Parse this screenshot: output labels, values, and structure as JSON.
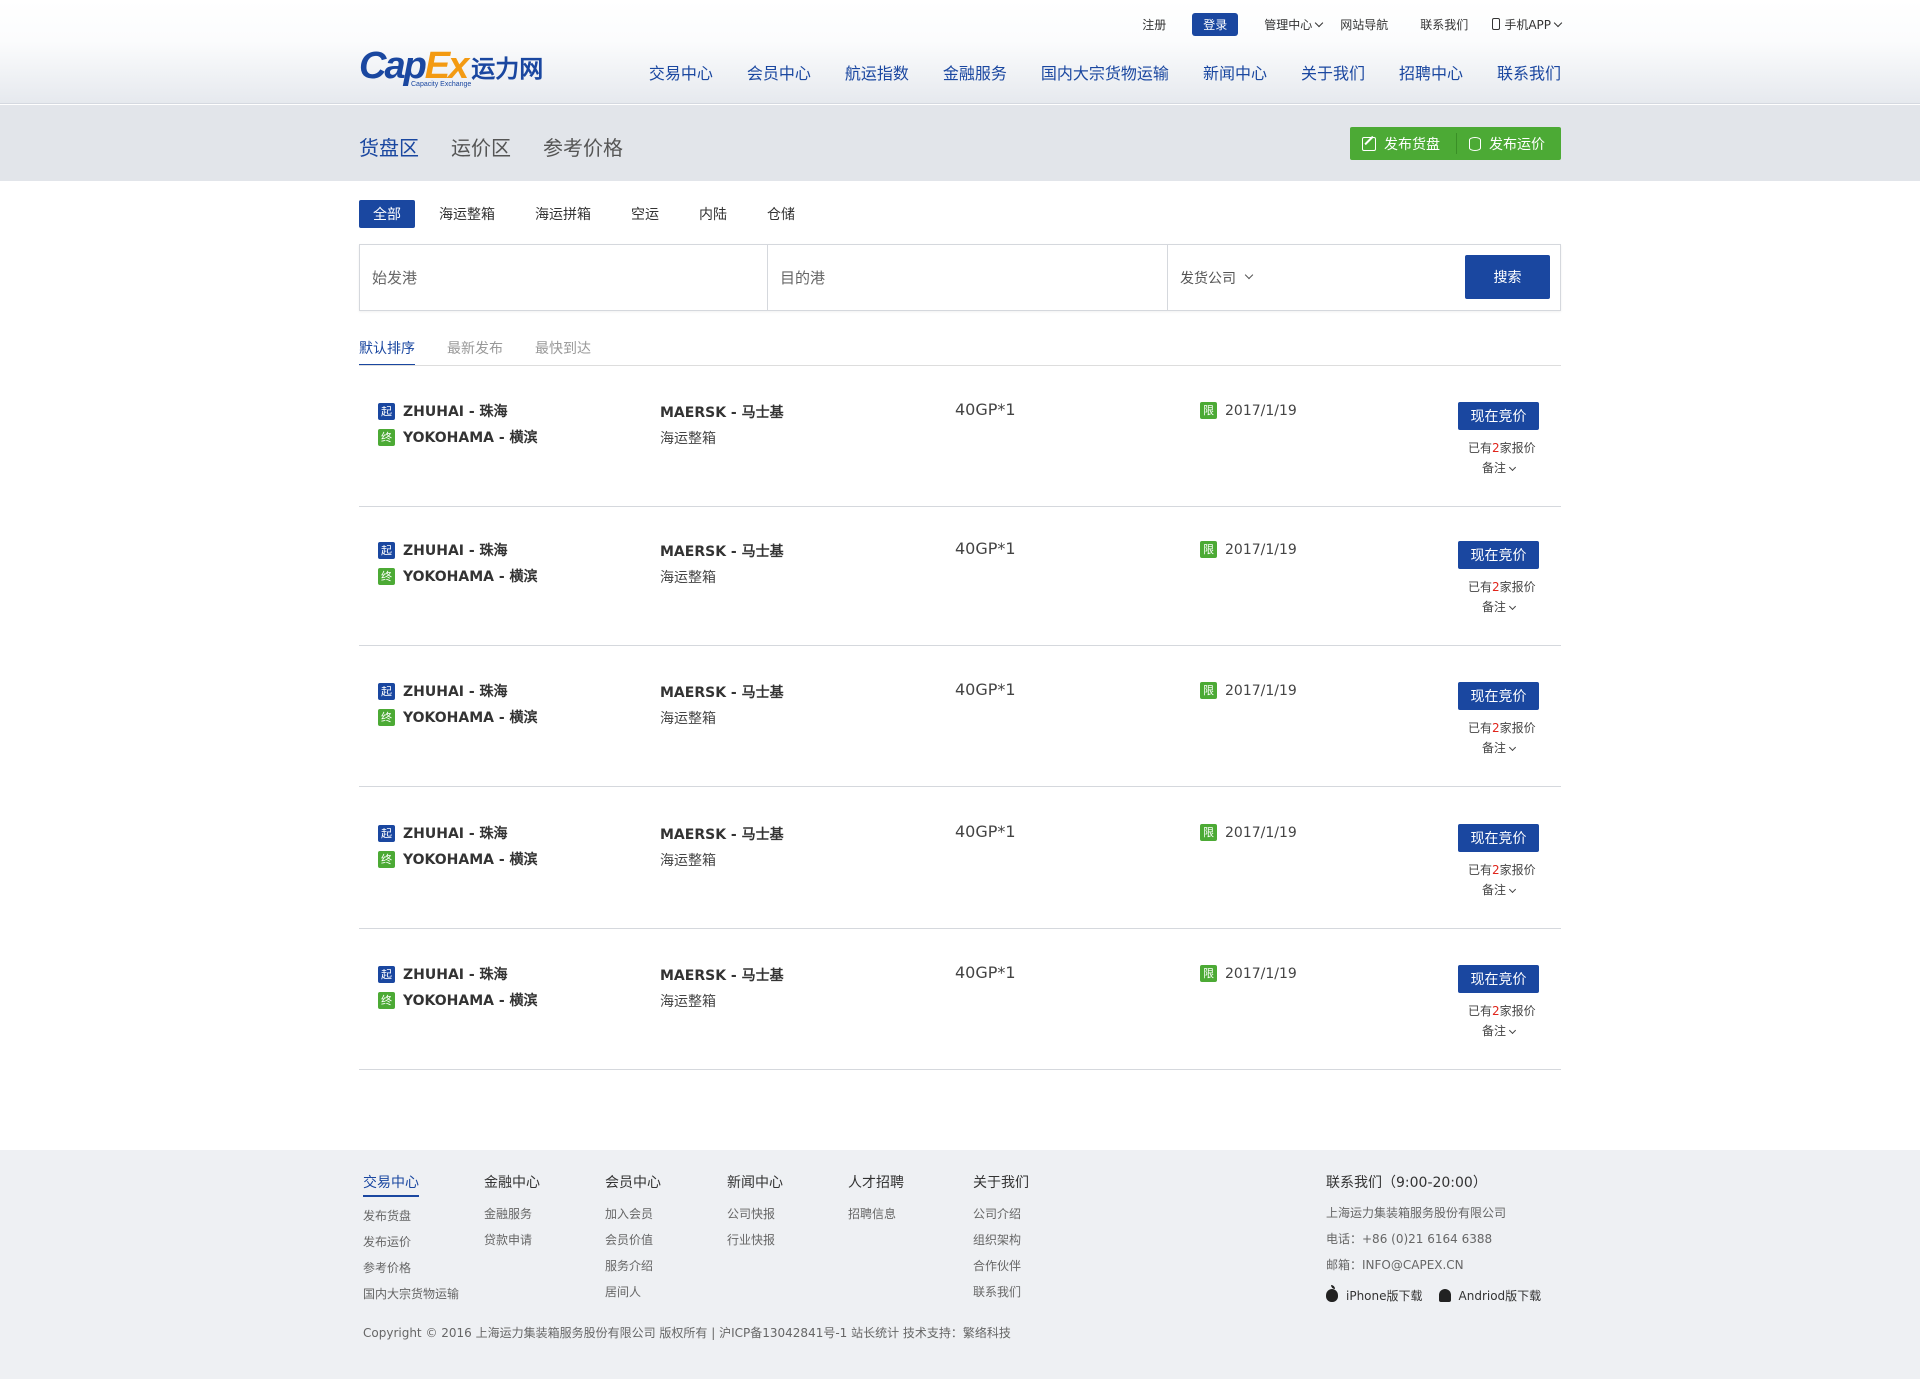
{
  "topnav": {
    "register": "注册",
    "login": "登录",
    "admin": "管理中心",
    "sitemap": "网站导航",
    "contact": "联系我们",
    "app": "手机APP"
  },
  "logo": {
    "cap": "Cap",
    "ex": "Ex",
    "cn": "运力网",
    "sub": "Capacity Exchange"
  },
  "mainnav": [
    "交易中心",
    "会员中心",
    "航运指数",
    "金融服务",
    "国内大宗货物运输",
    "新闻中心",
    "关于我们",
    "招聘中心",
    "联系我们"
  ],
  "subtabs": [
    "货盘区",
    "运价区",
    "参考价格"
  ],
  "publish": {
    "cargo": "发布货盘",
    "rate": "发布运价"
  },
  "filters": [
    "全部",
    "海运整箱",
    "海运拼箱",
    "空运",
    "内陆",
    "仓储"
  ],
  "search": {
    "origin_placeholder": "始发港",
    "dest_placeholder": "目的港",
    "company": "发货公司",
    "button": "搜索"
  },
  "sort": [
    "默认排序",
    "最新发布",
    "最快到达"
  ],
  "rows": [
    {
      "start_tag": "起",
      "origin": "ZHUHAI - 珠海",
      "end_tag": "终",
      "dest": "YOKOHAMA - 横滨",
      "carrier": "MAERSK - 马士基",
      "service": "海运整箱",
      "qty": "40GP*1",
      "limit_tag": "限",
      "date": "2017/1/19",
      "bid": "现在竞价",
      "offer_pre": "已有",
      "offer_num": "2",
      "offer_post": "家报价",
      "memo": "备注"
    },
    {
      "start_tag": "起",
      "origin": "ZHUHAI - 珠海",
      "end_tag": "终",
      "dest": "YOKOHAMA - 横滨",
      "carrier": "MAERSK - 马士基",
      "service": "海运整箱",
      "qty": "40GP*1",
      "limit_tag": "限",
      "date": "2017/1/19",
      "bid": "现在竞价",
      "offer_pre": "已有",
      "offer_num": "2",
      "offer_post": "家报价",
      "memo": "备注"
    },
    {
      "start_tag": "起",
      "origin": "ZHUHAI - 珠海",
      "end_tag": "终",
      "dest": "YOKOHAMA - 横滨",
      "carrier": "MAERSK - 马士基",
      "service": "海运整箱",
      "qty": "40GP*1",
      "limit_tag": "限",
      "date": "2017/1/19",
      "bid": "现在竞价",
      "offer_pre": "已有",
      "offer_num": "2",
      "offer_post": "家报价",
      "memo": "备注"
    },
    {
      "start_tag": "起",
      "origin": "ZHUHAI - 珠海",
      "end_tag": "终",
      "dest": "YOKOHAMA - 横滨",
      "carrier": "MAERSK - 马士基",
      "service": "海运整箱",
      "qty": "40GP*1",
      "limit_tag": "限",
      "date": "2017/1/19",
      "bid": "现在竞价",
      "offer_pre": "已有",
      "offer_num": "2",
      "offer_post": "家报价",
      "memo": "备注"
    },
    {
      "start_tag": "起",
      "origin": "ZHUHAI - 珠海",
      "end_tag": "终",
      "dest": "YOKOHAMA - 横滨",
      "carrier": "MAERSK - 马士基",
      "service": "海运整箱",
      "qty": "40GP*1",
      "limit_tag": "限",
      "date": "2017/1/19",
      "bid": "现在竞价",
      "offer_pre": "已有",
      "offer_num": "2",
      "offer_post": "家报价",
      "memo": "备注"
    }
  ],
  "footer": {
    "cols": [
      {
        "title": "交易中心",
        "links": [
          "发布货盘",
          "发布运价",
          "参考价格",
          "国内大宗货物运输"
        ]
      },
      {
        "title": "金融中心",
        "links": [
          "金融服务",
          "贷款申请"
        ]
      },
      {
        "title": "会员中心",
        "links": [
          "加入会员",
          "会员价值",
          "服务介绍",
          "居间人"
        ]
      },
      {
        "title": "新闻中心",
        "links": [
          "公司快报",
          "行业快报"
        ]
      },
      {
        "title": "人才招聘",
        "links": [
          "招聘信息"
        ]
      },
      {
        "title": "关于我们",
        "links": [
          "公司介绍",
          "组织架构",
          "合作伙伴",
          "联系我们"
        ]
      }
    ],
    "contact": {
      "title": "联系我们（9:00-20:00）",
      "company": "上海运力集装箱服务股份有限公司",
      "phone": "电话：+86 (0)21 6164 6388",
      "email": "邮箱：INFO@CAPEX.CN"
    },
    "apps": {
      "iphone": "iPhone版下载",
      "android": "Andriod版下载"
    },
    "copyright": "Copyright © 2016 上海运力集装箱服务股份有限公司 版权所有 | 沪ICP备13042841号-1  站长统计   技术支持：繁络科技"
  },
  "colors": {
    "brand": "#1a47a0",
    "accent": "#f39a12",
    "green": "#4caa35",
    "red": "#e0251b"
  }
}
